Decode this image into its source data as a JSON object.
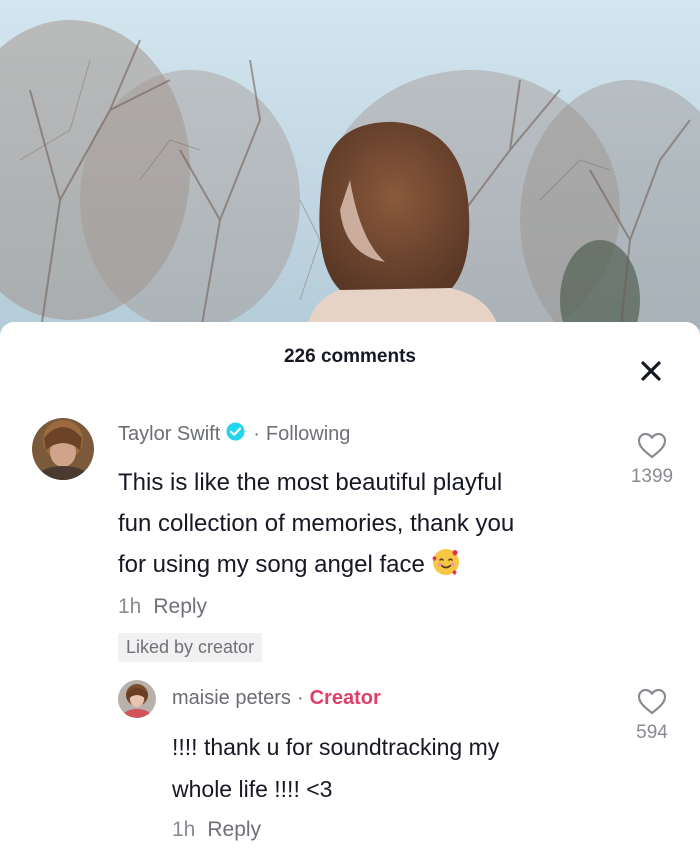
{
  "header": {
    "comment_count": "226 comments"
  },
  "icons": {
    "close": "close-icon",
    "like": "heart-outline-icon",
    "verified": "verified-badge-icon",
    "emoji": "smiling-face-with-hearts-emoji"
  },
  "colors": {
    "creator_tag": "#e03e6a",
    "verified": "#20d5ec",
    "text_primary": "#161823",
    "text_secondary": "#6f7078"
  },
  "comments": [
    {
      "username": "Taylor Swift",
      "separator": "·",
      "relation": "Following",
      "verified": true,
      "text": "This is like the most beautiful playful\nfun collection of memories, thank you\nfor using my song angel face",
      "time": "1h",
      "reply_label": "Reply",
      "badge": "Liked by creator",
      "likes": "1399"
    },
    {
      "username": "maisie peters",
      "separator": "·",
      "relation": "Creator",
      "text": "!!!! thank u for soundtracking my\nwhole life !!!! <3",
      "time": "1h",
      "reply_label": "Reply",
      "likes": "594"
    }
  ]
}
